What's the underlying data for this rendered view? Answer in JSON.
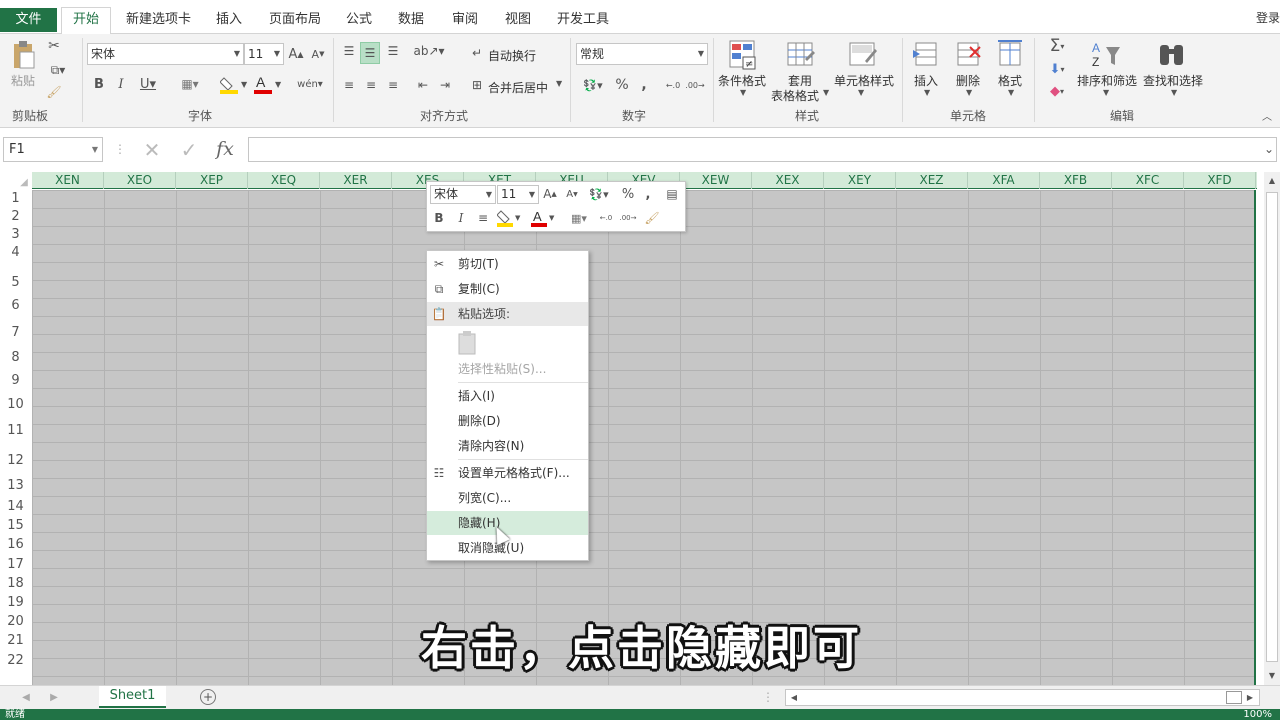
{
  "tabs": {
    "file": "文件",
    "items": [
      "开始",
      "新建选项卡",
      "插入",
      "页面布局",
      "公式",
      "数据",
      "审阅",
      "视图",
      "开发工具"
    ],
    "login": "登录"
  },
  "ribbon": {
    "clipboard": {
      "paste": "粘贴",
      "label": "剪贴板"
    },
    "font": {
      "name": "宋体",
      "size": "11",
      "label": "字体"
    },
    "align": {
      "wrap": "自动换行",
      "merge": "合并后居中",
      "label": "对齐方式"
    },
    "number": {
      "format": "常规",
      "label": "数字"
    },
    "styles": {
      "cond": "条件格式",
      "table1": "套用",
      "table2": "表格格式",
      "cell": "单元格样式",
      "label": "样式"
    },
    "cells": {
      "insert": "插入",
      "delete": "删除",
      "format": "格式",
      "label": "单元格"
    },
    "edit": {
      "sort": "排序和筛选",
      "find": "查找和选择",
      "label": "编辑"
    }
  },
  "formula": {
    "namebox": "F1",
    "fx": "fx"
  },
  "columns": [
    "XEN",
    "XEO",
    "XEP",
    "XEQ",
    "XER",
    "XES",
    "XET",
    "XEU",
    "XEV",
    "XEW",
    "XEX",
    "XEY",
    "XEZ",
    "XFA",
    "XFB",
    "XFC",
    "XFD"
  ],
  "rows": [
    "1",
    "2",
    "3",
    "4",
    "5",
    "6",
    "7",
    "8",
    "9",
    "10",
    "11",
    "12",
    "13",
    "14",
    "15",
    "16",
    "17",
    "18",
    "19",
    "20",
    "21",
    "22"
  ],
  "minitoolbar": {
    "font": "宋体",
    "size": "11"
  },
  "context_menu": {
    "cut": "剪切(T)",
    "copy": "复制(C)",
    "paste_header": "粘贴选项:",
    "paste_special": "选择性粘贴(S)...",
    "insert": "插入(I)",
    "delete": "删除(D)",
    "clear": "清除内容(N)",
    "format_cells": "设置单元格格式(F)...",
    "col_width": "列宽(C)...",
    "hide": "隐藏(H)",
    "unhide": "取消隐藏(U)"
  },
  "sheet_tab": "Sheet1",
  "status": {
    "left": "就绪",
    "zoom": "100%"
  },
  "caption": "右击，点击隐藏即可"
}
